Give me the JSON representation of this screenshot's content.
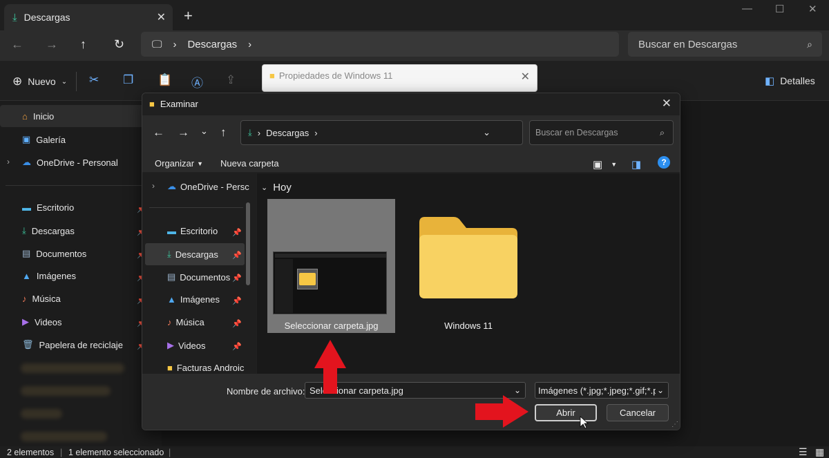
{
  "explorer": {
    "tab_title": "Descargas",
    "address_crumb": "Descargas",
    "search_placeholder": "Buscar en Descargas",
    "commands": {
      "new_label": "Nuevo",
      "details_label": "Detalles"
    },
    "sidebar": {
      "home": "Inicio",
      "gallery": "Galería",
      "onedrive": "OneDrive - Personal",
      "desktop": "Escritorio",
      "downloads": "Descargas",
      "documents": "Documentos",
      "pictures": "Imágenes",
      "music": "Música",
      "videos": "Videos",
      "recycle": "Papelera de reciclaje"
    },
    "status": {
      "count": "2 elementos",
      "selected": "1 elemento seleccionado"
    }
  },
  "properties_dialog": {
    "title": "Propiedades de Windows 11"
  },
  "browse_dialog": {
    "title": "Examinar",
    "address_crumb": "Descargas",
    "search_placeholder": "Buscar en Descargas",
    "toolbar": {
      "organize": "Organizar",
      "new_folder": "Nueva carpeta"
    },
    "sidebar": {
      "onedrive": "OneDrive - Persc",
      "desktop": "Escritorio",
      "downloads": "Descargas",
      "documents": "Documentos",
      "pictures": "Imágenes",
      "music": "Música",
      "videos": "Videos",
      "invoices": "Facturas Androic"
    },
    "group_header": "Hoy",
    "files": [
      {
        "name": "Seleccionar carpeta.jpg",
        "selected": true
      },
      {
        "name": "Windows 11",
        "selected": false
      }
    ],
    "filename_label": "Nombre de archivo:",
    "filename_value": "Seleccionar carpeta.jpg",
    "filetype_value": "Imágenes (*.jpg;*.jpeg;*.gif;*.pn",
    "open_button": "Abrir",
    "cancel_button": "Cancelar"
  },
  "colors": {
    "accent": "#6fb2ff",
    "folder": "#f6c744",
    "annotation_arrow": "#e3141e"
  }
}
